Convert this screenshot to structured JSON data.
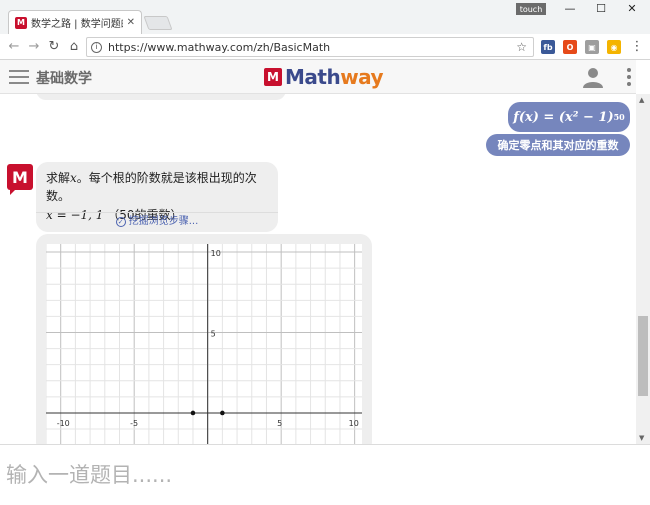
{
  "browser": {
    "tab_title": "数学之路 | 数学问题的解",
    "tab_favicon": "M",
    "tab_close": "✕",
    "touch_badge": "touch",
    "url": "https://www.mathway.com/zh/BasicMath",
    "window_controls": {
      "minimize": "—",
      "maximize": "☐",
      "close": "✕"
    },
    "nav": {
      "back": "←",
      "forward": "→",
      "reload": "↻",
      "info": "i",
      "star": "☆"
    },
    "extensions": [
      {
        "label": "fb",
        "color": "#3b5998"
      },
      {
        "label": "O",
        "color": "#e64a19"
      },
      {
        "label": "▣",
        "color": "#9e9e9e"
      },
      {
        "label": "◉",
        "color": "#f4b400"
      }
    ],
    "menu": "⋮"
  },
  "site": {
    "title": "基础数学",
    "logo_m": "M",
    "logo_word_a": "Math",
    "logo_word_b": "way"
  },
  "chat": {
    "user_expr_base": "f(x) = (x² − 1)",
    "user_expr_exp": "50",
    "user_command": "确定零点和其对应的重数",
    "bot_avatar": "M",
    "bot_line1_pre": "求解",
    "bot_line1_var": "x",
    "bot_line1_post": "。每个根的阶数就是该根出现的次数。",
    "bot_line2_math": "x = −1, 1",
    "bot_line2_note": "（50的重数）",
    "steps_check": "✓",
    "steps_link": "挖掘浏览步骤..."
  },
  "chart_data": {
    "type": "scatter",
    "xlim": [
      -11,
      10.5
    ],
    "ylim": [
      -2.8,
      10.5
    ],
    "grid": true,
    "x_ticks": [
      "-10",
      "-5",
      "5",
      "10"
    ],
    "y_ticks": [
      "5",
      "10"
    ],
    "points": [
      {
        "x": -1,
        "y": 0
      },
      {
        "x": 1,
        "y": 0
      }
    ]
  },
  "input": {
    "placeholder": "输入一道题目......"
  }
}
